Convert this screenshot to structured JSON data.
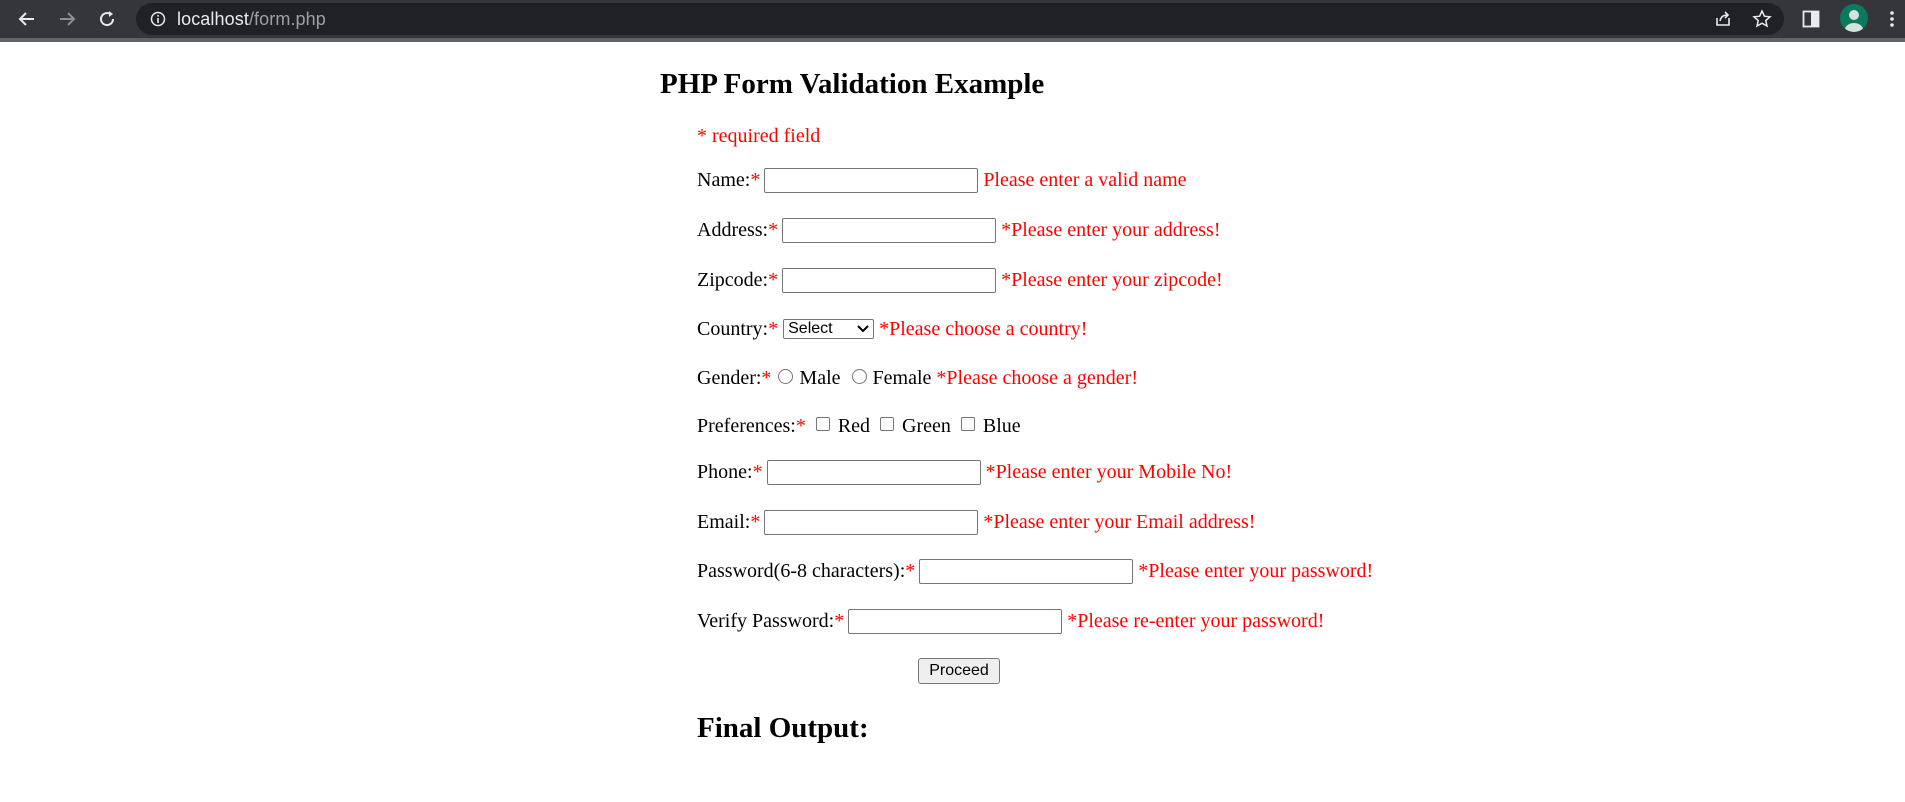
{
  "browser": {
    "url_host": "localhost",
    "url_path": "/form.php"
  },
  "page": {
    "title": "PHP Form Validation Example",
    "required_note": "* required field",
    "required_mark": "*",
    "fields": {
      "name": {
        "label": "Name:",
        "value": "",
        "error": "Please enter a valid name"
      },
      "address": {
        "label": "Address:",
        "value": "",
        "error": "*Please enter your address!"
      },
      "zipcode": {
        "label": "Zipcode:",
        "value": "",
        "error": "*Please enter your zipcode!"
      },
      "country": {
        "label": "Country:",
        "selected": "Select",
        "error": "*Please choose a country!"
      },
      "gender": {
        "label": "Gender:",
        "options": [
          "Male",
          "Female"
        ],
        "error": "*Please choose a gender!"
      },
      "preferences": {
        "label": "Preferences:",
        "options": [
          "Red",
          "Green",
          "Blue"
        ]
      },
      "phone": {
        "label": "Phone:",
        "value": "",
        "error": "*Please enter your Mobile No!"
      },
      "email": {
        "label": "Email:",
        "value": "",
        "error": "*Please enter your Email address!"
      },
      "password": {
        "label": "Password(6-8 characters):",
        "value": "",
        "error": "*Please enter your password!"
      },
      "verify_password": {
        "label": "Verify Password:",
        "value": "",
        "error": "*Please re-enter your password!"
      }
    },
    "submit_label": "Proceed",
    "output_heading": "Final Output:"
  }
}
